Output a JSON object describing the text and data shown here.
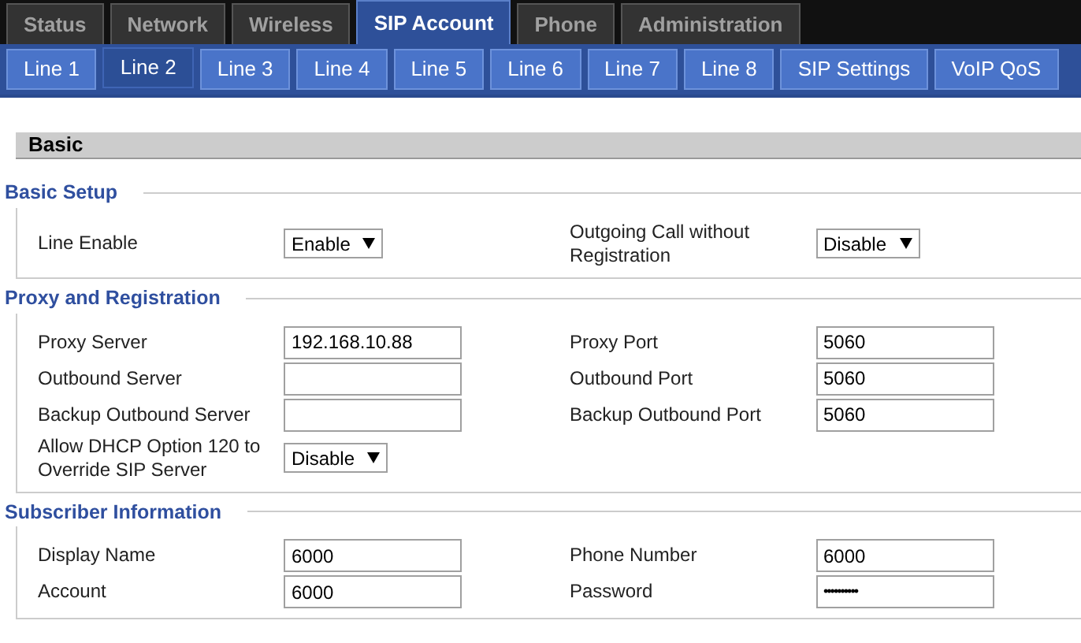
{
  "top_tabs": [
    {
      "label": "Status",
      "selected": false
    },
    {
      "label": "Network",
      "selected": false
    },
    {
      "label": "Wireless",
      "selected": false
    },
    {
      "label": "SIP Account",
      "selected": true
    },
    {
      "label": "Phone",
      "selected": false
    },
    {
      "label": "Administration",
      "selected": false
    }
  ],
  "line_tabs": [
    {
      "label": "Line 1",
      "selected": false
    },
    {
      "label": "Line 2",
      "selected": true
    },
    {
      "label": "Line 3",
      "selected": false
    },
    {
      "label": "Line 4",
      "selected": false
    },
    {
      "label": "Line 5",
      "selected": false
    },
    {
      "label": "Line 6",
      "selected": false
    },
    {
      "label": "Line 7",
      "selected": false
    },
    {
      "label": "Line 8",
      "selected": false
    },
    {
      "label": "SIP Settings",
      "selected": false
    },
    {
      "label": "VoIP QoS",
      "selected": false
    }
  ],
  "page_header": "Basic",
  "sections": [
    {
      "title": "Basic Setup",
      "rows": [
        [
          {
            "label": "Line Enable",
            "kind": "select",
            "value": "Enable"
          },
          {
            "label": "Outgoing Call without Registration",
            "kind": "select",
            "value": "Disable"
          }
        ]
      ]
    },
    {
      "title": "Proxy and Registration",
      "rows": [
        [
          {
            "label": "Proxy Server",
            "kind": "text",
            "value": "192.168.10.88"
          },
          {
            "label": "Proxy Port",
            "kind": "text",
            "value": "5060"
          }
        ],
        [
          {
            "label": "Outbound Server",
            "kind": "text"
          },
          {
            "label": "Outbound Port",
            "kind": "text",
            "value": "5060"
          }
        ],
        [
          {
            "label": "Backup Outbound Server",
            "kind": "text"
          },
          {
            "label": "Backup Outbound Port",
            "kind": "text",
            "value": "5060"
          }
        ],
        [
          {
            "label": "Allow DHCP Option 120 to Override SIP Server",
            "kind": "select",
            "value": "Disable"
          }
        ]
      ]
    },
    {
      "title": "Subscriber Information",
      "rows": [
        [
          {
            "label": "Display Name",
            "kind": "text",
            "value": "6000"
          },
          {
            "label": "Phone Number",
            "kind": "text",
            "value": "6000"
          }
        ],
        [
          {
            "label": "Account",
            "kind": "text",
            "value": "6000"
          },
          {
            "label": "Password",
            "kind": "password",
            "value": "••••••••••"
          }
        ]
      ]
    }
  ]
}
